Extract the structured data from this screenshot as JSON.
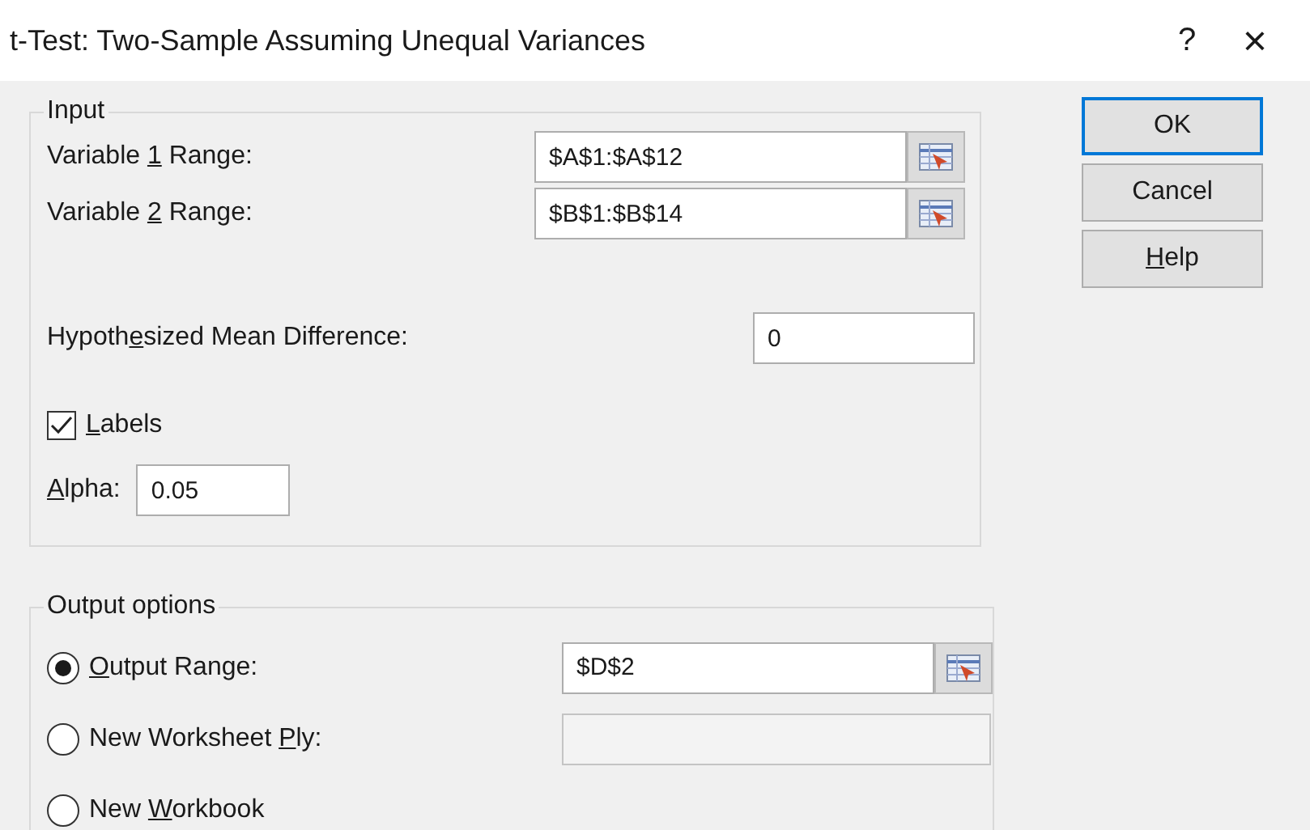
{
  "window": {
    "title": "t-Test: Two-Sample Assuming Unequal Variances",
    "help": "?",
    "close": "×"
  },
  "input": {
    "title": "Input",
    "fields": [
      {
        "kind": "range",
        "label": {
          "pre": "Variable ",
          "key": "1",
          "post": " Range:"
        },
        "value": "$A$1:$A$12"
      },
      {
        "kind": "range",
        "label": {
          "pre": "Variable ",
          "key": "2",
          "post": " Range:"
        },
        "value": "$B$1:$B$14"
      },
      {
        "kind": "number",
        "label": {
          "pre": "Hypoth",
          "key": "e",
          "post": "sized Mean Difference:"
        },
        "value": "0"
      }
    ],
    "labels_checkbox": {
      "label": {
        "key": "L",
        "post": "abels"
      },
      "checked": true
    },
    "alpha": {
      "label": {
        "key": "A",
        "post": "lpha:"
      },
      "value": "0.05"
    }
  },
  "output": {
    "title": "Output options",
    "options": [
      {
        "label": {
          "key": "O",
          "post": "utput Range:"
        },
        "selected": true,
        "field": {
          "kind": "range",
          "value": "$D$2",
          "disabled": false
        }
      },
      {
        "label": {
          "pre": "New Worksheet ",
          "key": "P",
          "post": "ly:"
        },
        "selected": false,
        "field": {
          "kind": "text",
          "disabled": true
        }
      },
      {
        "label": {
          "pre": "New ",
          "key": "W",
          "post": "orkbook"
        },
        "selected": false
      }
    ]
  },
  "buttons": [
    {
      "label": {
        "pre": "OK"
      },
      "default": true
    },
    {
      "label": {
        "pre": "Cancel"
      },
      "default": false
    },
    {
      "label": {
        "key": "H",
        "post": "elp"
      },
      "default": false
    }
  ]
}
